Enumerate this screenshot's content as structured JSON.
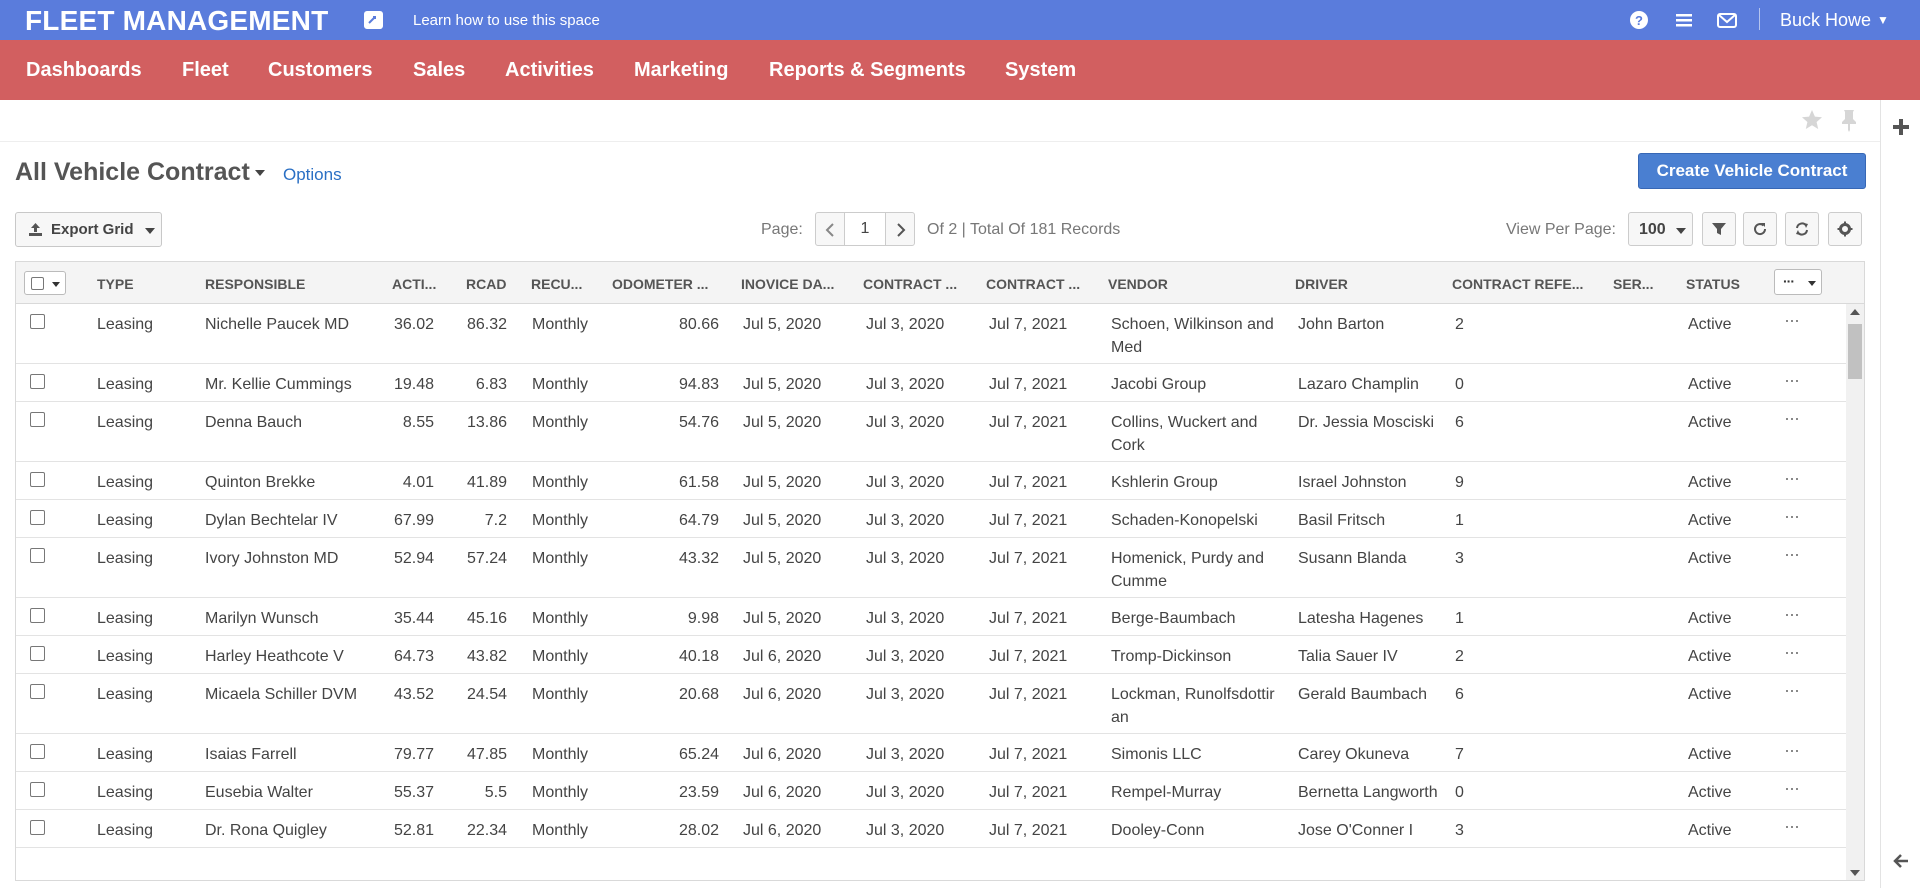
{
  "header": {
    "brand": "FLEET MANAGEMENT",
    "learn_link": "Learn how to use this space",
    "user_name": "Buck Howe"
  },
  "nav": {
    "items": [
      "Dashboards",
      "Fleet",
      "Customers",
      "Sales",
      "Activities",
      "Marketing",
      "Reports & Segments",
      "System"
    ]
  },
  "page": {
    "title": "All Vehicle Contract",
    "options_link": "Options",
    "create_button": "Create Vehicle Contract"
  },
  "toolbar": {
    "export_label": "Export Grid",
    "page_label": "Page:",
    "page_value": "1",
    "page_info": "Of 2 | Total Of 181 Records",
    "view_per_page_label": "View Per Page:",
    "view_per_page_value": "100"
  },
  "grid": {
    "columns": [
      "TYPE",
      "RESPONSIBLE",
      "ACTI...",
      "RCAD",
      "RECU...",
      "ODOMETER ...",
      "INOVICE DA...",
      "CONTRACT ...",
      "CONTRACT ...",
      "VENDOR",
      "DRIVER",
      "CONTRACT REFE...",
      "SER...",
      "STATUS"
    ],
    "more_glyph": "···",
    "rows": [
      {
        "type": "Leasing",
        "responsible": "Nichelle Paucek MD",
        "acti": "36.02",
        "rcad": "86.32",
        "recu": "Monthly",
        "odometer": "80.66",
        "invoice_date": "Jul 5, 2020",
        "contract_start": "Jul 3, 2020",
        "contract_end": "Jul 7, 2021",
        "vendor": "Schoen, Wilkinson and Med",
        "driver": "John Barton",
        "contract_ref": "2",
        "ser": "",
        "status": "Active"
      },
      {
        "type": "Leasing",
        "responsible": "Mr. Kellie Cummings",
        "acti": "19.48",
        "rcad": "6.83",
        "recu": "Monthly",
        "odometer": "94.83",
        "invoice_date": "Jul 5, 2020",
        "contract_start": "Jul 3, 2020",
        "contract_end": "Jul 7, 2021",
        "vendor": "Jacobi Group",
        "driver": "Lazaro Champlin",
        "contract_ref": "0",
        "ser": "",
        "status": "Active"
      },
      {
        "type": "Leasing",
        "responsible": "Denna Bauch",
        "acti": "8.55",
        "rcad": "13.86",
        "recu": "Monthly",
        "odometer": "54.76",
        "invoice_date": "Jul 5, 2020",
        "contract_start": "Jul 3, 2020",
        "contract_end": "Jul 7, 2021",
        "vendor": "Collins, Wuckert and Cork",
        "driver": "Dr. Jessia Mosciski",
        "contract_ref": "6",
        "ser": "",
        "status": "Active"
      },
      {
        "type": "Leasing",
        "responsible": "Quinton Brekke",
        "acti": "4.01",
        "rcad": "41.89",
        "recu": "Monthly",
        "odometer": "61.58",
        "invoice_date": "Jul 5, 2020",
        "contract_start": "Jul 3, 2020",
        "contract_end": "Jul 7, 2021",
        "vendor": "Kshlerin Group",
        "driver": "Israel Johnston",
        "contract_ref": "9",
        "ser": "",
        "status": "Active"
      },
      {
        "type": "Leasing",
        "responsible": "Dylan Bechtelar IV",
        "acti": "67.99",
        "rcad": "7.2",
        "recu": "Monthly",
        "odometer": "64.79",
        "invoice_date": "Jul 5, 2020",
        "contract_start": "Jul 3, 2020",
        "contract_end": "Jul 7, 2021",
        "vendor": "Schaden-Konopelski",
        "driver": "Basil Fritsch",
        "contract_ref": "1",
        "ser": "",
        "status": "Active"
      },
      {
        "type": "Leasing",
        "responsible": "Ivory Johnston MD",
        "acti": "52.94",
        "rcad": "57.24",
        "recu": "Monthly",
        "odometer": "43.32",
        "invoice_date": "Jul 5, 2020",
        "contract_start": "Jul 3, 2020",
        "contract_end": "Jul 7, 2021",
        "vendor": "Homenick, Purdy and Cumme",
        "driver": "Susann Blanda",
        "contract_ref": "3",
        "ser": "",
        "status": "Active"
      },
      {
        "type": "Leasing",
        "responsible": "Marilyn Wunsch",
        "acti": "35.44",
        "rcad": "45.16",
        "recu": "Monthly",
        "odometer": "9.98",
        "invoice_date": "Jul 5, 2020",
        "contract_start": "Jul 3, 2020",
        "contract_end": "Jul 7, 2021",
        "vendor": "Berge-Baumbach",
        "driver": "Latesha Hagenes",
        "contract_ref": "1",
        "ser": "",
        "status": "Active"
      },
      {
        "type": "Leasing",
        "responsible": "Harley Heathcote V",
        "acti": "64.73",
        "rcad": "43.82",
        "recu": "Monthly",
        "odometer": "40.18",
        "invoice_date": "Jul 6, 2020",
        "contract_start": "Jul 3, 2020",
        "contract_end": "Jul 7, 2021",
        "vendor": "Tromp-Dickinson",
        "driver": "Talia Sauer IV",
        "contract_ref": "2",
        "ser": "",
        "status": "Active"
      },
      {
        "type": "Leasing",
        "responsible": "Micaela Schiller DVM",
        "acti": "43.52",
        "rcad": "24.54",
        "recu": "Monthly",
        "odometer": "20.68",
        "invoice_date": "Jul 6, 2020",
        "contract_start": "Jul 3, 2020",
        "contract_end": "Jul 7, 2021",
        "vendor": "Lockman, Runolfsdottir an",
        "driver": "Gerald Baumbach",
        "contract_ref": "6",
        "ser": "",
        "status": "Active"
      },
      {
        "type": "Leasing",
        "responsible": "Isaias Farrell",
        "acti": "79.77",
        "rcad": "47.85",
        "recu": "Monthly",
        "odometer": "65.24",
        "invoice_date": "Jul 6, 2020",
        "contract_start": "Jul 3, 2020",
        "contract_end": "Jul 7, 2021",
        "vendor": "Simonis LLC",
        "driver": "Carey Okuneva",
        "contract_ref": "7",
        "ser": "",
        "status": "Active"
      },
      {
        "type": "Leasing",
        "responsible": "Eusebia Walter",
        "acti": "55.37",
        "rcad": "5.5",
        "recu": "Monthly",
        "odometer": "23.59",
        "invoice_date": "Jul 6, 2020",
        "contract_start": "Jul 3, 2020",
        "contract_end": "Jul 7, 2021",
        "vendor": "Rempel-Murray",
        "driver": "Bernetta Langworth",
        "contract_ref": "0",
        "ser": "",
        "status": "Active"
      },
      {
        "type": "Leasing",
        "responsible": "Dr. Rona Quigley",
        "acti": "52.81",
        "rcad": "22.34",
        "recu": "Monthly",
        "odometer": "28.02",
        "invoice_date": "Jul 6, 2020",
        "contract_start": "Jul 3, 2020",
        "contract_end": "Jul 7, 2021",
        "vendor": "Dooley-Conn",
        "driver": "Jose O'Conner I",
        "contract_ref": "3",
        "ser": "",
        "status": "Active"
      }
    ]
  }
}
